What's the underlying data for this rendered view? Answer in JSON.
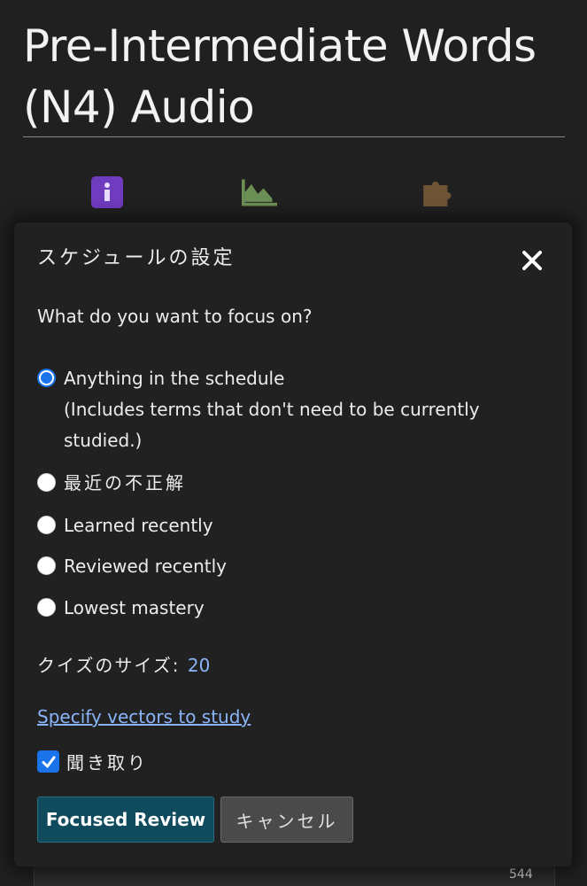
{
  "page": {
    "title": "Pre-Intermediate Words (N4) Audio",
    "footer_number": "544"
  },
  "background_icons": [
    {
      "name": "info-icon",
      "color": "#6f3bbf"
    },
    {
      "name": "chart-icon",
      "color": "#6b8f55"
    },
    {
      "name": "puzzle-icon",
      "color": "#6e5434"
    }
  ],
  "modal": {
    "title": "スケジュールの設定",
    "question": "What do you want to focus on?",
    "options": [
      {
        "label": "Anything in the schedule",
        "sub": "(Includes terms that don't need to be currently studied.)",
        "checked": true
      },
      {
        "label": "最近の不正解",
        "checked": false
      },
      {
        "label": "Learned recently",
        "checked": false
      },
      {
        "label": "Reviewed recently",
        "checked": false
      },
      {
        "label": "Lowest mastery",
        "checked": false
      }
    ],
    "quiz_size_label": "クイズのサイズ:",
    "quiz_size_value": "20",
    "vectors_link": "Specify vectors to study",
    "checkbox": {
      "label": "聞き取り",
      "checked": true
    },
    "buttons": {
      "primary": "Focused Review",
      "cancel": "キャンセル"
    }
  },
  "colors": {
    "accent": "#1a73e8",
    "link": "#8ab4f8",
    "primary_button": "#0f4b5c",
    "modal_bg": "#212121"
  }
}
